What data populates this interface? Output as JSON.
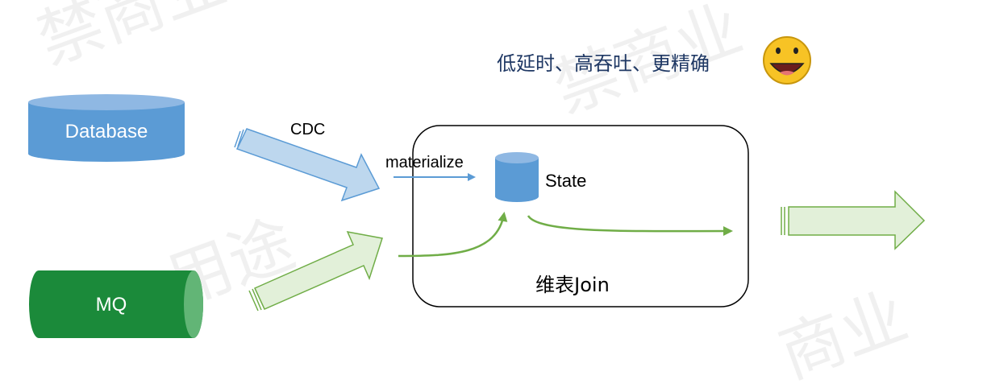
{
  "headline": "低延时、高吞吐、更精确",
  "emoji": {
    "icon": "smiley-face-icon",
    "color": "#f7c325"
  },
  "sources": {
    "database": {
      "label": "Database",
      "color": "#5b9bd5"
    },
    "mq": {
      "label": "MQ",
      "color": "#1b8a3a"
    }
  },
  "arrows": {
    "cdc_label": "CDC",
    "materialize_label": "materialize"
  },
  "join_box": {
    "title": "维表Join",
    "state_label": "State"
  },
  "colors": {
    "blue_arrow_fill": "#bdd7ee",
    "blue_arrow_stroke": "#5b9bd5",
    "green_arrow_fill": "#e2f0d9",
    "green_arrow_stroke": "#70ad47"
  }
}
